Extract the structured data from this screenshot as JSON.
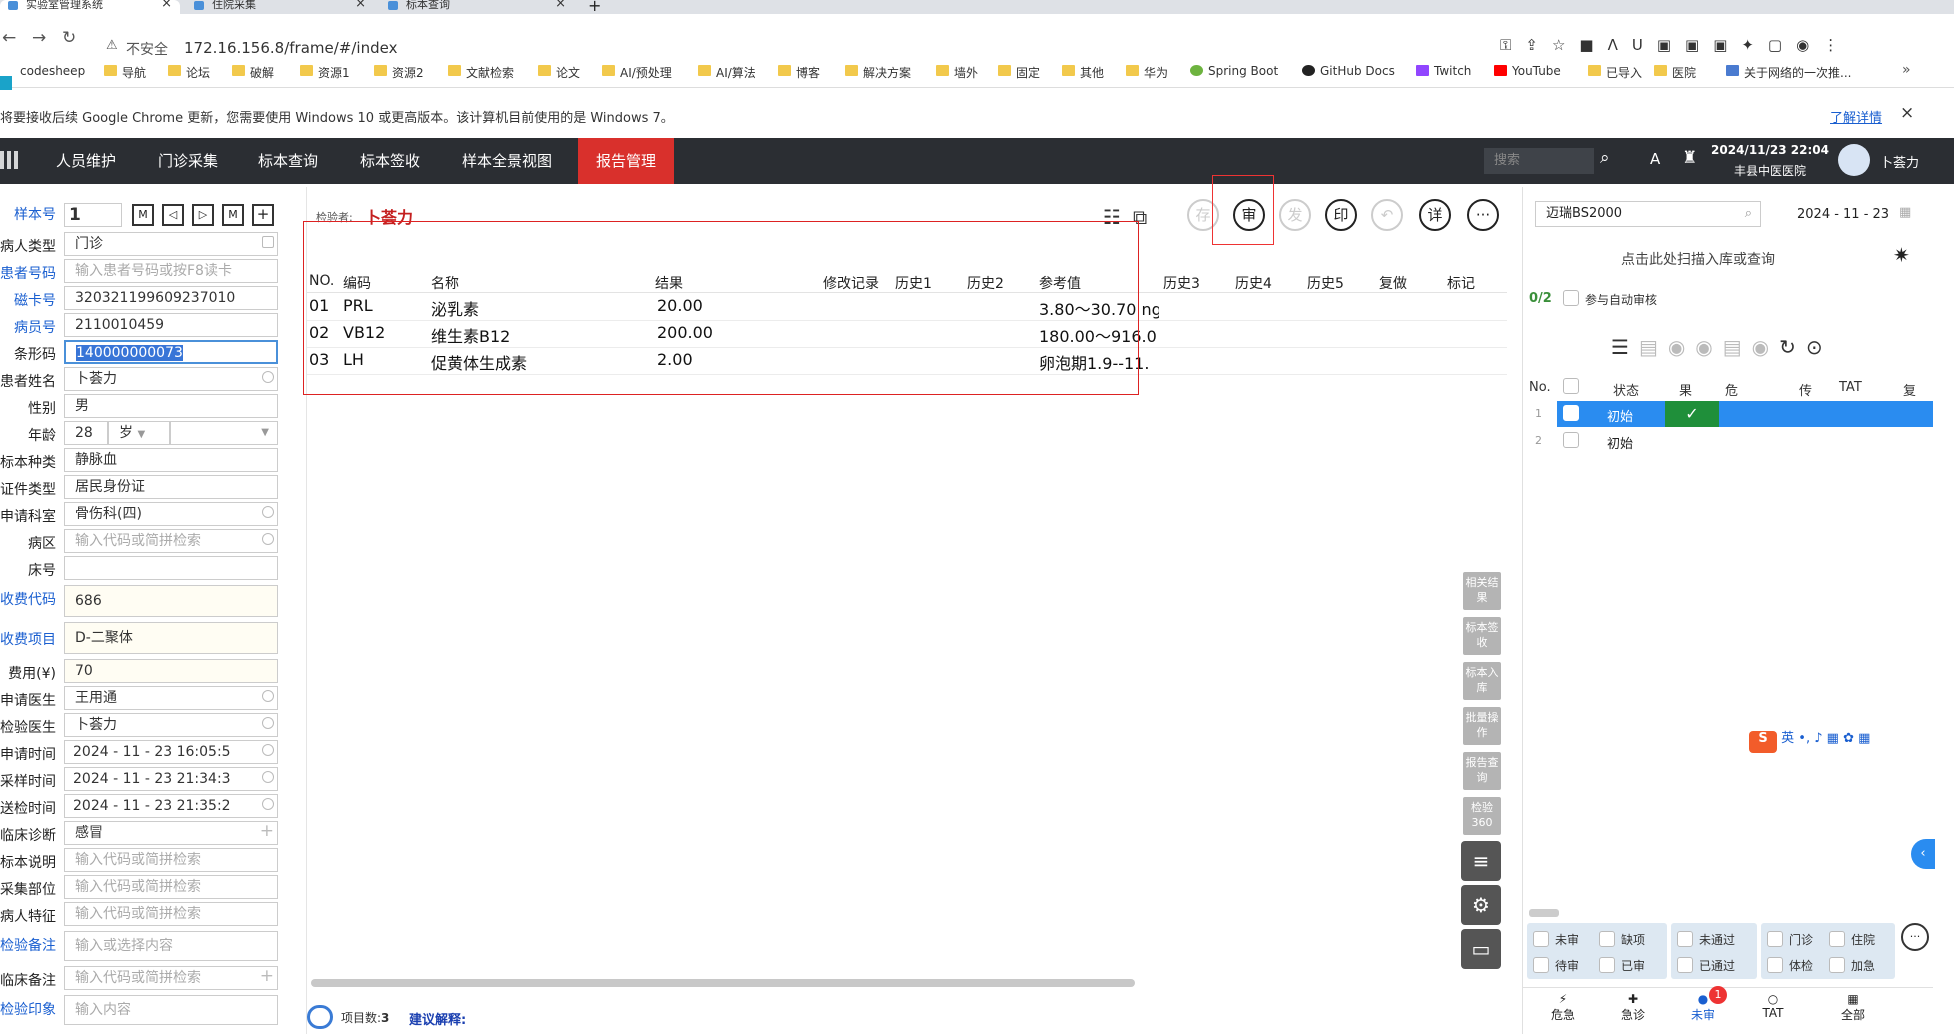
{
  "browser": {
    "tabs": [
      "实验室管理系统",
      "住院采集",
      "标本查询"
    ],
    "not_secure": "不安全",
    "url": "172.16.156.8/frame/#/index",
    "bookmarks": [
      "codesheep",
      "导航",
      "论坛",
      "破解",
      "资源1",
      "资源2",
      "文献检索",
      "论文",
      "AI/预处理",
      "AI/算法",
      "博客",
      "解决方案",
      "墙外",
      "固定",
      "其他",
      "华为",
      "Spring Boot",
      "GitHub Docs",
      "Twitch",
      "YouTube",
      "已导入",
      "医院",
      "关于网络的一次推..."
    ],
    "info_text": "将要接收后续 Google Chrome 更新，您需要使用 Windows 10 或更高版本。该计算机目前使用的是 Windows 7。",
    "info_link": "了解详情"
  },
  "app": {
    "nav": [
      "人员维护",
      "门诊采集",
      "标本查询",
      "标本签收",
      "样本全景视图",
      "报告管理"
    ],
    "search_placeholder": "搜索",
    "datetime": "2024/11/23 22:04",
    "hospital": "丰县中医医院",
    "user": "卜荟力"
  },
  "left": {
    "sample_no_label": "样本号",
    "sample_no": "1",
    "fields": [
      {
        "label": "病人类型",
        "value": "门诊",
        "ph": false
      },
      {
        "label": "患者号码",
        "value": "输入患者号码或按F8读卡",
        "ph": true
      },
      {
        "label": "磁卡号",
        "value": "320321199609237010",
        "ph": false
      },
      {
        "label": "病员号",
        "value": "2110010459",
        "ph": false
      },
      {
        "label": "条形码",
        "value": "140000000073",
        "ph": false
      },
      {
        "label": "患者姓名",
        "value": "卜荟力",
        "ph": false
      },
      {
        "label": "性别",
        "value": "男",
        "ph": false
      },
      {
        "label": "年龄",
        "value": "28",
        "ph": false
      },
      {
        "label": "标本种类",
        "value": "静脉血",
        "ph": false
      },
      {
        "label": "证件类型",
        "value": "居民身份证",
        "ph": false
      },
      {
        "label": "申请科室",
        "value": "骨伤科(四)",
        "ph": false
      },
      {
        "label": "病区",
        "value": "输入代码或简拼检索",
        "ph": true
      },
      {
        "label": "床号",
        "value": "",
        "ph": false
      },
      {
        "label": "收费代码",
        "value": "686",
        "ph": false
      },
      {
        "label": "收费项目",
        "value": "D-二聚体",
        "ph": false
      },
      {
        "label": "费用(¥)",
        "value": "70",
        "ph": false
      },
      {
        "label": "申请医生",
        "value": "王用通",
        "ph": false
      },
      {
        "label": "检验医生",
        "value": "卜荟力",
        "ph": false
      },
      {
        "label": "申请时间",
        "value": "2024 - 11 - 23   16:05:5",
        "ph": false
      },
      {
        "label": "采样时间",
        "value": "2024 - 11 - 23   21:34:3",
        "ph": false
      },
      {
        "label": "送检时间",
        "value": "2024 - 11 - 23   21:35:2",
        "ph": false
      },
      {
        "label": "临床诊断",
        "value": "感冒",
        "ph": false
      },
      {
        "label": "标本说明",
        "value": "输入代码或简拼检索",
        "ph": true
      },
      {
        "label": "采集部位",
        "value": "输入代码或简拼检索",
        "ph": true
      },
      {
        "label": "病人特征",
        "value": "输入代码或简拼检索",
        "ph": true
      },
      {
        "label": "检验备注",
        "value": "输入或选择内容",
        "ph": true
      },
      {
        "label": "临床备注",
        "value": "输入代码或简拼检索",
        "ph": true
      },
      {
        "label": "检验印象",
        "value": "输入内容",
        "ph": true
      }
    ],
    "age_unit": "岁"
  },
  "center": {
    "inspector_label": "检验者:",
    "inspector": "卜荟力",
    "toolbar": [
      "存",
      "审",
      "发",
      "印",
      "",
      "详",
      ""
    ],
    "columns": [
      "NO.",
      "编码",
      "名称",
      "结果",
      "修改记录",
      "历史1",
      "历史2",
      "参考值",
      "历史3",
      "历史4",
      "历史5",
      "复做",
      "标记"
    ],
    "rows": [
      {
        "no": "01",
        "code": "PRL",
        "name": "泌乳素",
        "result": "20.00",
        "ref": "3.80～30.70 ng"
      },
      {
        "no": "02",
        "code": "VB12",
        "name": "维生素B12",
        "result": "200.00",
        "ref": "180.00～916.0"
      },
      {
        "no": "03",
        "code": "LH",
        "name": "促黄体生成素",
        "result": "2.00",
        "ref": "卵泡期1.9--11."
      }
    ],
    "side_buttons": [
      "相关结果",
      "标本签收",
      "标本入库",
      "批量操作",
      "报告查询",
      "检验360"
    ],
    "item_count_label": "项目数:",
    "item_count": "3",
    "suggest_label": "建议解释:"
  },
  "right": {
    "instrument": "迈瑞BS2000",
    "date": "2024 - 11 - 23",
    "scan_text": "点击此处扫描入库或查询",
    "auto_count": "0/2",
    "auto_label": "参与自动审核",
    "columns": [
      "No.",
      "状态",
      "果",
      "危",
      "传",
      "TAT",
      "复"
    ],
    "rows": [
      {
        "no": "1",
        "status": "初始"
      },
      {
        "no": "2",
        "status": "初始"
      }
    ],
    "filters": [
      "未审",
      "缺项",
      "未通过",
      "门诊",
      "住院",
      "待审",
      "已审",
      "已通过",
      "体检",
      "加急"
    ],
    "bottom_tabs": [
      "危急",
      "急诊",
      "未审",
      "TAT",
      "全部"
    ],
    "badge": "1",
    "ime": "英"
  }
}
